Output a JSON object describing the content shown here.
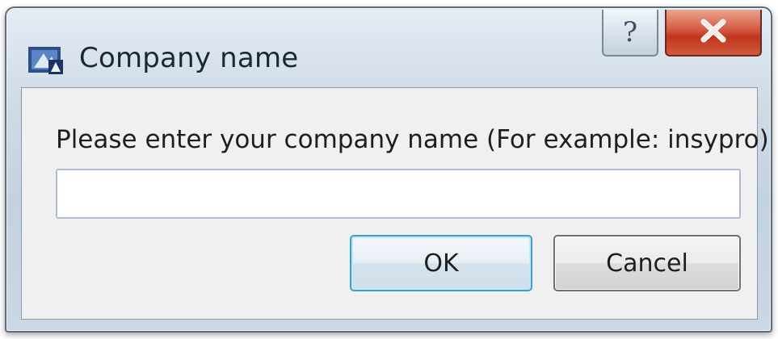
{
  "dialog": {
    "title": "Company name",
    "prompt": "Please enter your company name (For example: insypro)",
    "company_input": {
      "value": "",
      "placeholder": ""
    },
    "buttons": {
      "ok_label": "OK",
      "cancel_label": "Cancel"
    }
  },
  "titlebar": {
    "help_glyph": "?",
    "icons": {
      "app": "application-icon",
      "help": "help-icon",
      "close": "close-icon"
    }
  },
  "colors": {
    "close_button": "#c9452b",
    "frame_glass": "#cad7e4",
    "client_bg": "#f0f0f0",
    "ok_focus_border": "#3c9fd0"
  }
}
